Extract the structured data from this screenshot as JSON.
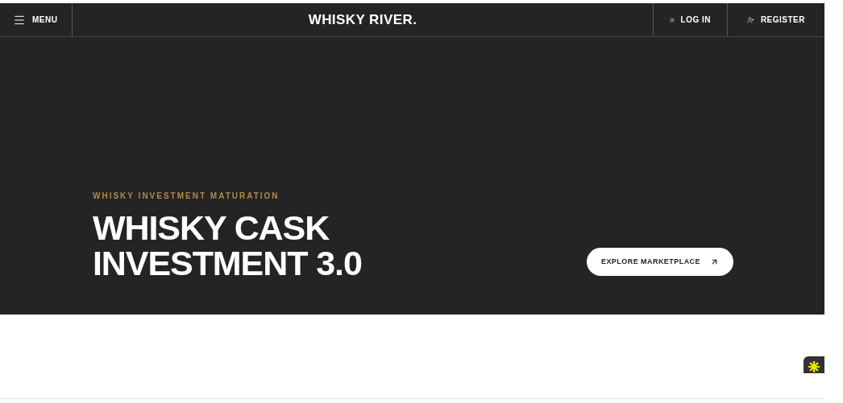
{
  "header": {
    "menu": "MENU",
    "logo": "WHISKY RIVER.",
    "login": "LOG IN",
    "register": "REGISTER"
  },
  "hero": {
    "eyebrow": "WHISKY INVESTMENT MATURATION",
    "title_lines": [
      "WHISKY CASK",
      "INVESTMENT 3.0"
    ],
    "cta": "EXPLORE MARKETPLACE"
  }
}
